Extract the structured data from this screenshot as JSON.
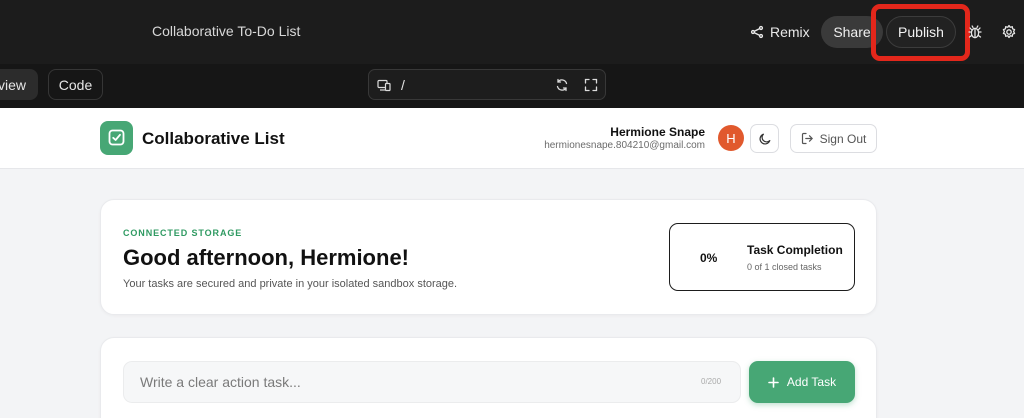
{
  "topbar": {
    "title": "Collaborative To-Do List",
    "remix_label": "Remix",
    "share_label": "Share",
    "publish_label": "Publish"
  },
  "subbar": {
    "preview_tab_label": "view",
    "code_tab_label": "Code",
    "url_path": "/"
  },
  "app": {
    "brand_name": "Collaborative List",
    "user": {
      "name": "Hermione Snape",
      "email": "hermionesnape.804210@gmail.com",
      "avatar_initial": "H"
    },
    "signout_label": "Sign Out",
    "welcome": {
      "storage_label": "CONNECTED STORAGE",
      "greeting": "Good afternoon, Hermione!",
      "subtitle": "Your tasks are secured and private in your isolated sandbox storage."
    },
    "completion": {
      "percent": "0%",
      "title": "Task Completion",
      "count": "0 of 1 closed tasks"
    },
    "task_input": {
      "placeholder": "Write a clear action task...",
      "char_count": "0/200",
      "add_label": "Add Task"
    }
  },
  "colors": {
    "accent_green": "#47a775",
    "avatar_orange": "#e1592d",
    "highlight_red": "#e3271b",
    "topbar_bg": "#1c1c1c"
  },
  "icons": [
    "remix-icon",
    "bug-icon",
    "gear-icon",
    "devices-icon",
    "refresh-icon",
    "expand-icon",
    "wand-icon",
    "checkbox-logo-icon",
    "moon-icon",
    "sign-out-icon",
    "plus-icon"
  ]
}
